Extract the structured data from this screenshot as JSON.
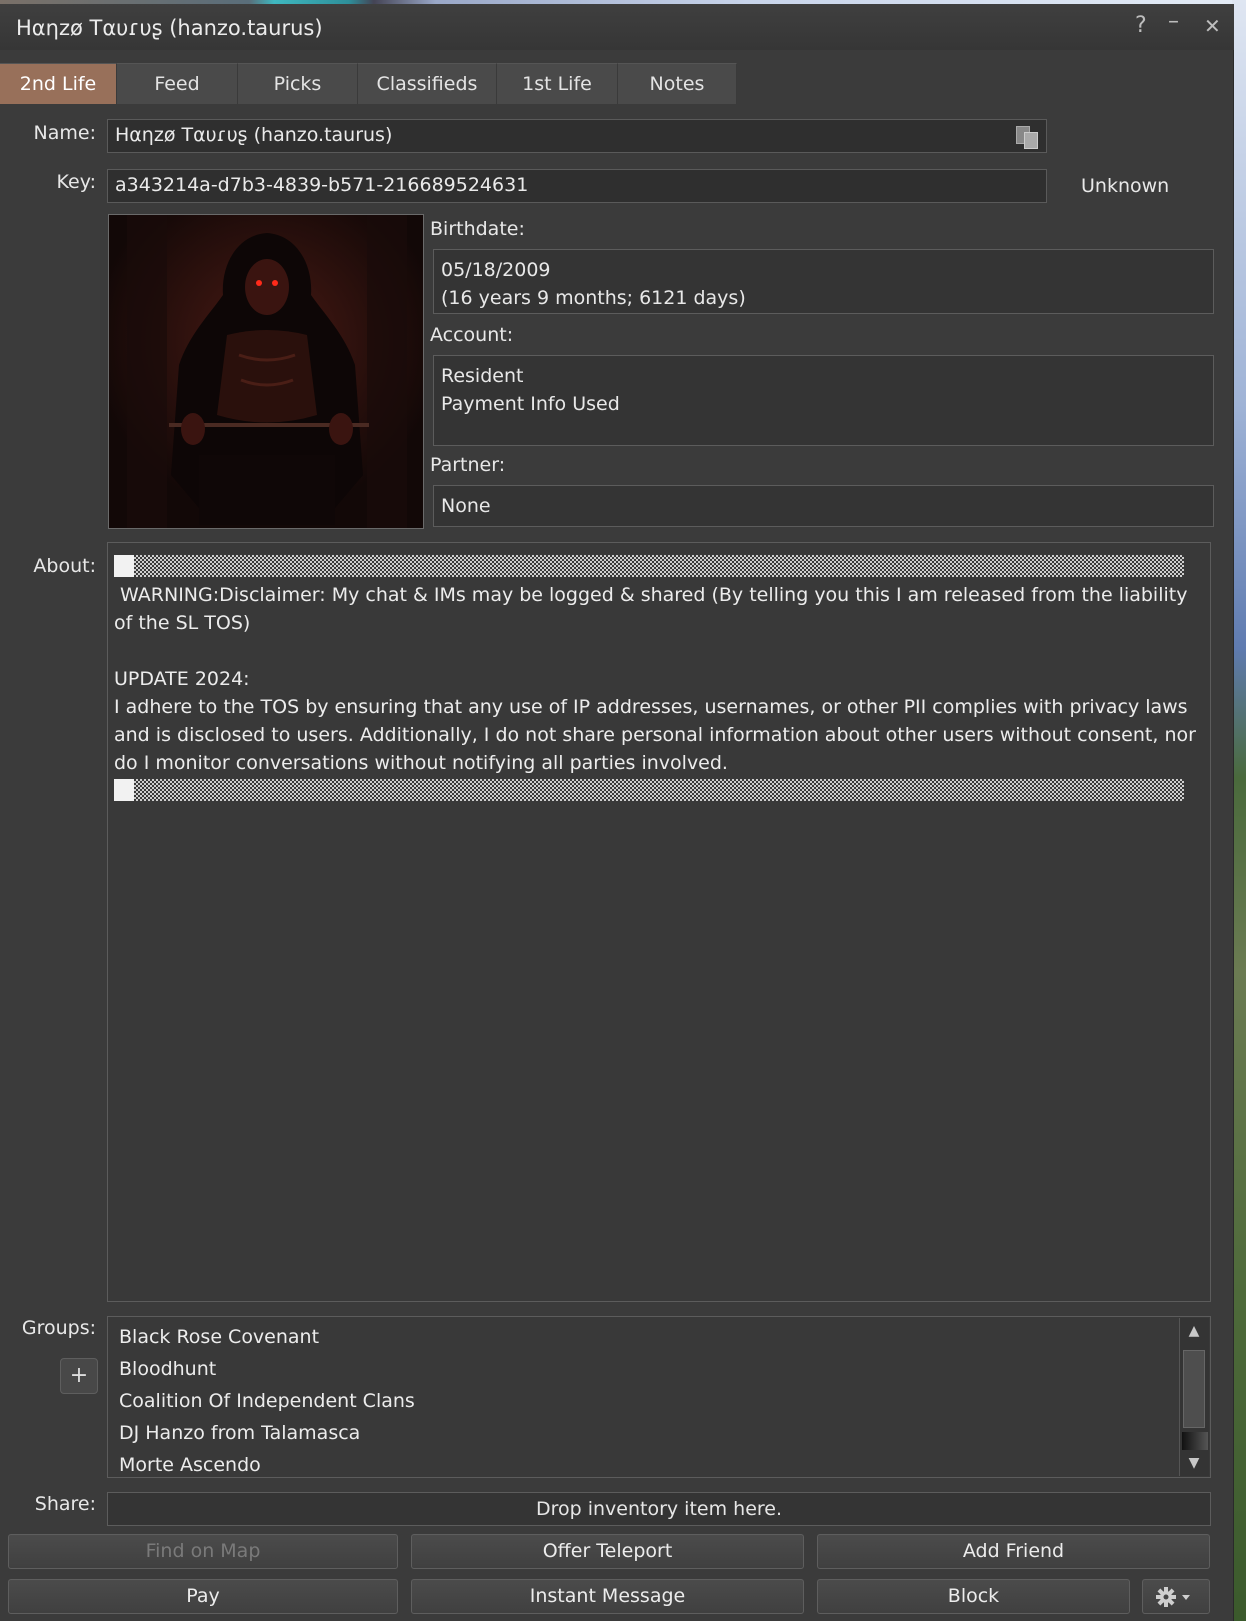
{
  "window": {
    "title": "Hαηzø Tαυɾυʂ (hanzo.taurus)",
    "help_icon": "?",
    "minimize_icon": "–",
    "close_icon": "✕"
  },
  "tabs": [
    {
      "label": "2nd Life",
      "active": true
    },
    {
      "label": "Feed"
    },
    {
      "label": "Picks"
    },
    {
      "label": "Classifieds"
    },
    {
      "label": "1st Life"
    },
    {
      "label": "Notes"
    }
  ],
  "profile": {
    "name_label": "Name:",
    "name_value": "Hαηzø Tαυɾυʂ (hanzo.taurus)",
    "key_label": "Key:",
    "key_value": "a343214a-d7b3-4839-b571-216689524631",
    "online_status": "Unknown",
    "birthdate_label": "Birthdate:",
    "birthdate_line1": "05/18/2009",
    "birthdate_line2": "(16 years 9 months; 6121 days)",
    "account_label": "Account:",
    "account_line1": "Resident",
    "account_line2": "Payment Info Used",
    "partner_label": "Partner:",
    "partner_value": "None",
    "about_label": "About:",
    "about_text": " WARNING:Disclaimer: My chat & IMs may be logged & shared (By telling you this I am released from the liability of the SL TOS)\n\nUPDATE 2024:\nI adhere to the TOS by ensuring that any use of IP addresses, usernames, or other PII complies with privacy laws and is disclosed to users. Additionally, I do not share personal information about other users without consent, nor do I monitor conversations without notifying all parties involved.",
    "groups_label": "Groups:",
    "groups": [
      "Black Rose Covenant",
      "Bloodhunt",
      "Coalition Of Independent Clans",
      "DJ Hanzo from Talamasca",
      "Morte Ascendo"
    ],
    "add_group_label": "+",
    "share_label": "Share:",
    "share_placeholder": "Drop inventory item here."
  },
  "buttons": {
    "find_on_map": "Find on Map",
    "offer_teleport": "Offer Teleport",
    "add_friend": "Add Friend",
    "pay": "Pay",
    "instant_message": "Instant Message",
    "block": "Block"
  },
  "icons": {
    "copy": "copy-icon",
    "gear": "gear-icon"
  }
}
